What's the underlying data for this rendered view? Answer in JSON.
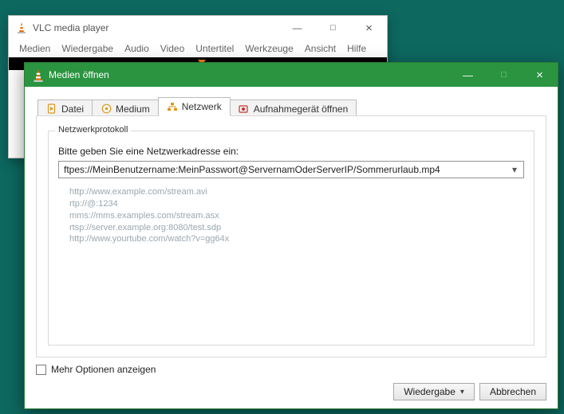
{
  "main_window": {
    "title": "VLC media player",
    "menu": [
      "Medien",
      "Wiedergabe",
      "Audio",
      "Video",
      "Untertitel",
      "Werkzeuge",
      "Ansicht",
      "Hilfe"
    ]
  },
  "dialog": {
    "title": "Medien öffnen",
    "tabs": {
      "file": "Datei",
      "disc": "Medium",
      "network": "Netzwerk",
      "capture": "Aufnahmegerät öffnen"
    },
    "group_legend": "Netzwerkprotokoll",
    "prompt": "Bitte geben Sie eine Netzwerkadresse ein:",
    "url_value": "ftpes://MeinBenutzername:MeinPasswort@ServernamOderServerIP/Sommerurlaub.mp4",
    "examples": [
      "http://www.example.com/stream.avi",
      "rtp://@:1234",
      "mms://mms.examples.com/stream.asx",
      "rtsp://server.example.org:8080/test.sdp",
      "http://www.yourtube.com/watch?v=gg64x"
    ],
    "more_options": "Mehr Optionen anzeigen",
    "play_button": "Wiedergabe",
    "cancel_button": "Abbrechen"
  }
}
